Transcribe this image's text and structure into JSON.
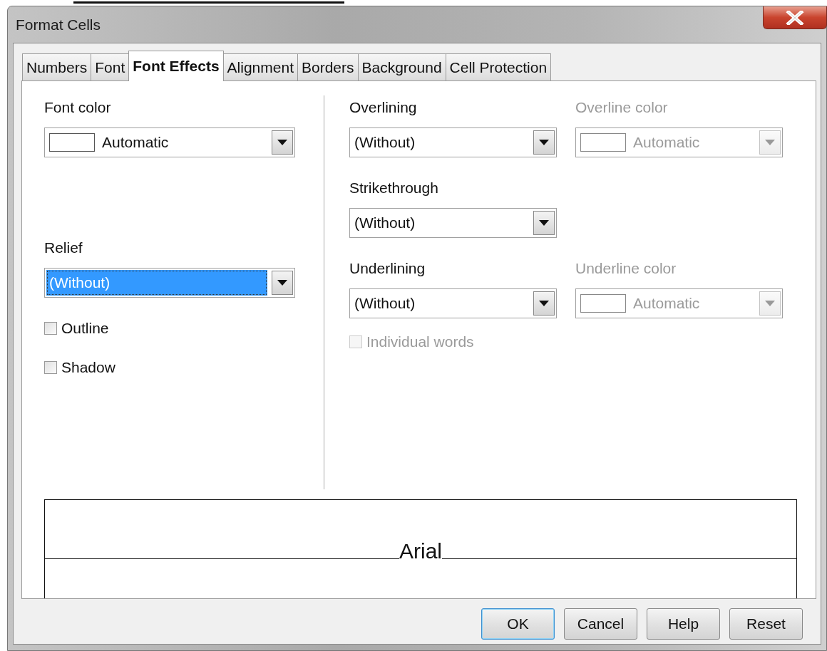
{
  "window": {
    "title": "Format Cells"
  },
  "tabs": [
    {
      "label": "Numbers",
      "selected": false
    },
    {
      "label": "Font",
      "selected": false
    },
    {
      "label": "Font Effects",
      "selected": true
    },
    {
      "label": "Alignment",
      "selected": false
    },
    {
      "label": "Borders",
      "selected": false
    },
    {
      "label": "Background",
      "selected": false
    },
    {
      "label": "Cell Protection",
      "selected": false
    }
  ],
  "left": {
    "fields": [
      {
        "kind": "color",
        "label": "Font color",
        "value": "Automatic",
        "disabled": false,
        "focused": false
      },
      {
        "kind": "list",
        "label": "Relief",
        "value": "(Without)",
        "disabled": false,
        "focused": true
      }
    ],
    "checkboxes": [
      {
        "label": "Outline",
        "checked": false,
        "disabled": false
      },
      {
        "label": "Shadow",
        "checked": false,
        "disabled": false
      }
    ]
  },
  "right": {
    "rows": [
      [
        {
          "kind": "list",
          "label": "Overlining",
          "value": "(Without)",
          "disabled": false,
          "focused": false
        },
        {
          "kind": "color",
          "label": "Overline color",
          "value": "Automatic",
          "disabled": true,
          "focused": false
        }
      ],
      [
        {
          "kind": "list",
          "label": "Strikethrough",
          "value": "(Without)",
          "disabled": false,
          "focused": false
        }
      ],
      [
        {
          "kind": "list",
          "label": "Underlining",
          "value": "(Without)",
          "disabled": false,
          "focused": false
        },
        {
          "kind": "color",
          "label": "Underline color",
          "value": "Automatic",
          "disabled": true,
          "focused": false
        }
      ]
    ],
    "checkboxes": [
      {
        "label": "Individual words",
        "checked": false,
        "disabled": true
      }
    ]
  },
  "preview": {
    "sample": "Arial"
  },
  "buttons": [
    {
      "label": "OK",
      "default": true
    },
    {
      "label": "Cancel",
      "default": false
    },
    {
      "label": "Help",
      "default": false
    },
    {
      "label": "Reset",
      "default": false
    }
  ]
}
